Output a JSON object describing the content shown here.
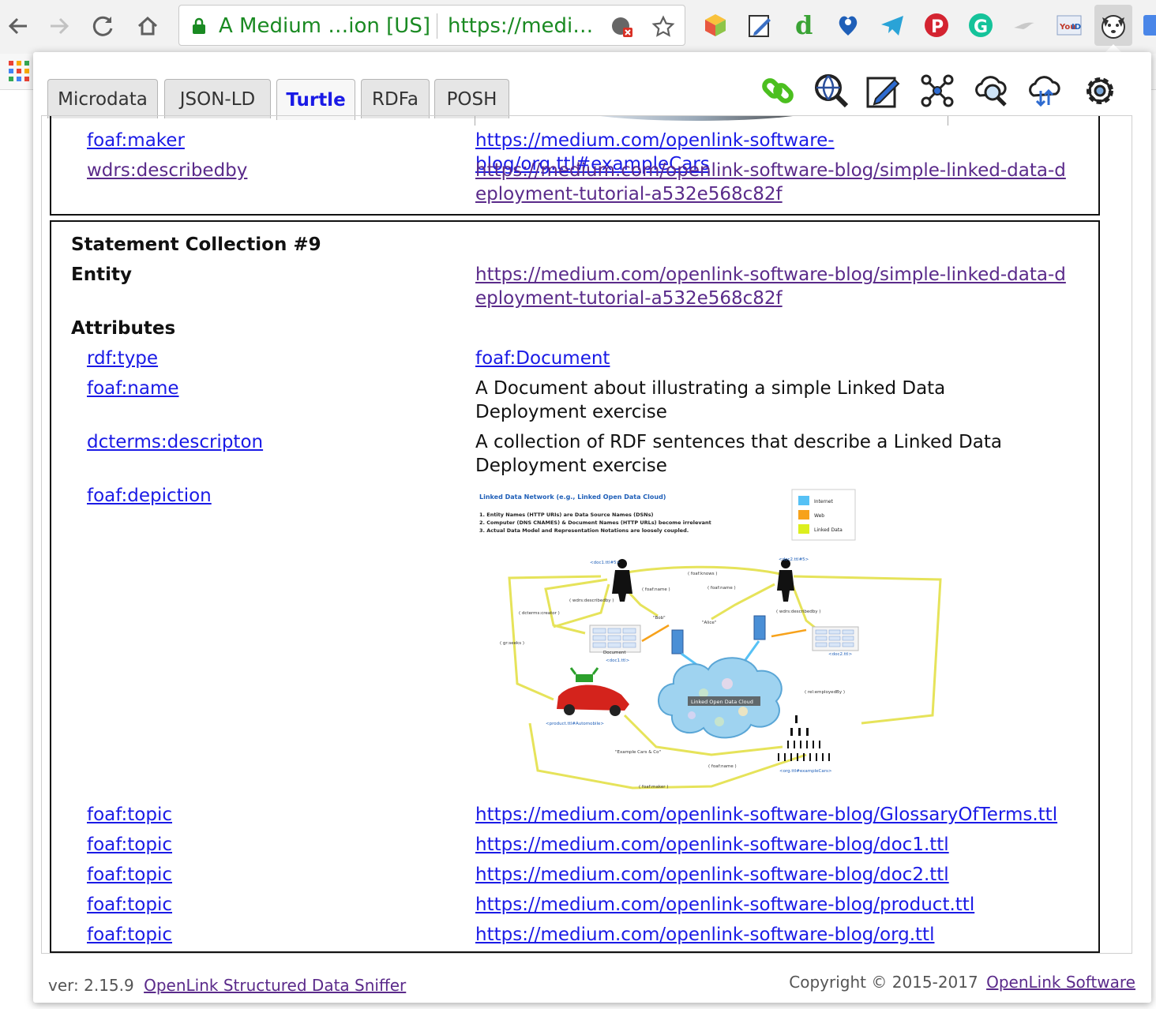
{
  "browser": {
    "omnibox_title": "A Medium …ion [US]",
    "omnibox_url": "https://medi…"
  },
  "popup": {
    "tabs": [
      {
        "label": "Microdata",
        "active": false
      },
      {
        "label": "JSON-LD",
        "active": false
      },
      {
        "label": "Turtle",
        "active": true
      },
      {
        "label": "RDFa",
        "active": false
      },
      {
        "label": "POSH",
        "active": false
      }
    ],
    "prev_collection": {
      "rows": [
        {
          "predicate": "foaf:maker",
          "value": "https://medium.com/openlink-software-blog/org.ttl#exampleCars"
        },
        {
          "predicate": "wdrs:describedby",
          "value": "https://medium.com/openlink-software-blog/simple-linked-data-deployment-tutorial-a532e568c82f"
        }
      ]
    },
    "collection": {
      "title": "Statement Collection #9",
      "entity_label": "Entity",
      "entity_value": "https://medium.com/openlink-software-blog/simple-linked-data-deployment-tutorial-a532e568c82f",
      "attributes_label": "Attributes",
      "attributes": [
        {
          "predicate": "rdf:type",
          "value": "foaf:Document"
        },
        {
          "predicate": "foaf:name",
          "value": "A Document about illustrating a simple Linked Data Deployment exercise"
        },
        {
          "predicate": "dcterms:descripton",
          "value": "A collection of RDF sentences that describe a Linked Data Deployment exercise"
        },
        {
          "predicate": "foaf:depiction",
          "value": ""
        }
      ],
      "topics": [
        {
          "predicate": "foaf:topic",
          "value": "https://medium.com/openlink-software-blog/GlossaryOfTerms.ttl"
        },
        {
          "predicate": "foaf:topic",
          "value": "https://medium.com/openlink-software-blog/doc1.ttl"
        },
        {
          "predicate": "foaf:topic",
          "value": "https://medium.com/openlink-software-blog/doc2.ttl"
        },
        {
          "predicate": "foaf:topic",
          "value": "https://medium.com/openlink-software-blog/product.ttl"
        },
        {
          "predicate": "foaf:topic",
          "value": "https://medium.com/openlink-software-blog/org.ttl"
        }
      ]
    },
    "diagram": {
      "title": "Linked Data Network (e.g., Linked Open Data Cloud)",
      "notes": [
        "1. Entity Names (HTTP URIs) are Data Source Names (DSNs)",
        "2. Computer (DNS CNAMES) & Document Names (HTTP URLs) become irrelevant",
        "3. Actual Data Model and Representation Notations are loosely coupled."
      ],
      "legend": [
        "Internet",
        "Web",
        "Linked Data"
      ],
      "labels": {
        "doc1_bob": "<doc1.ttl#5>",
        "doc2_alice": "<doc2.ttl#5>",
        "knows": "( foaf:knows )",
        "name1": "( foaf:name )",
        "name2": "( foaf:name )",
        "describedby1": "( wdrs:describedby )",
        "describedby2": "( wdrs:describedby )",
        "creator": "( dcterms:creator )",
        "seeks": "( gr:seeks )",
        "bob": "\"Bob\"",
        "alice": "\"Alice\"",
        "document": "Document",
        "doc1": "<doc1.ttl>",
        "doc2": "<doc2.ttl>",
        "cloud": "Linked Open Data Cloud",
        "employed": "( rel:employedBy )",
        "product": "<product.ttl#Automobile>",
        "example_cars": "\"Example Cars & Co\"",
        "name3": "( foaf:name )",
        "org": "<org.ttl#exampleCars>",
        "maker": "( foaf:maker )"
      }
    },
    "footer": {
      "version": "ver: 2.15.9",
      "sniffer_link": "OpenLink Structured Data Sniffer",
      "copyright": "Copyright © 2015-2017",
      "company_link": "OpenLink Software"
    }
  },
  "colors": {
    "link": "#1a1ae6",
    "visited_link": "#5a2a8a",
    "url_green": "#1a8a22",
    "legend_internet": "#56c1f5",
    "legend_web": "#f7a21b",
    "legend_linked_data": "#dcef1e"
  }
}
